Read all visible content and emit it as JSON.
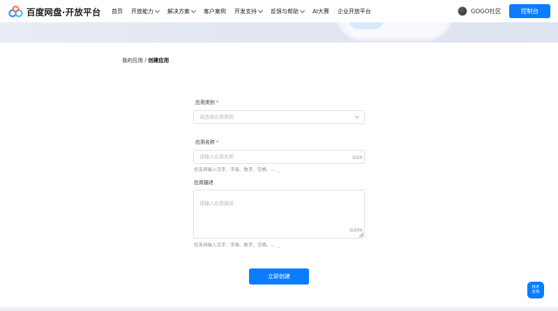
{
  "header": {
    "logo_text": "百度网盘·开放平台",
    "nav": [
      {
        "label": "首页",
        "has_dropdown": false
      },
      {
        "label": "开放能力",
        "has_dropdown": true
      },
      {
        "label": "解决方案",
        "has_dropdown": true
      },
      {
        "label": "客户案例",
        "has_dropdown": false
      },
      {
        "label": "开发支持",
        "has_dropdown": true
      },
      {
        "label": "反馈与帮助",
        "has_dropdown": true
      },
      {
        "label": "AI大赛",
        "has_dropdown": false
      },
      {
        "label": "企业开放平台",
        "has_dropdown": false
      }
    ],
    "user_name": "GOGO社区",
    "console_label": "控制台"
  },
  "breadcrumb": {
    "parent": "我的应用",
    "separator": "/",
    "current": "创建应用"
  },
  "form": {
    "category": {
      "label": "应用类别",
      "required_mark": "*",
      "placeholder": "请选择应用类别"
    },
    "name": {
      "label": "应用名称",
      "required_mark": "*",
      "placeholder": "请输入应用名称",
      "counter": "0/20",
      "hint": "仅支持输入汉字、字母、数字、空格、-、_"
    },
    "description": {
      "label": "应用描述",
      "placeholder": "请输入应用描述",
      "counter": "0/200",
      "hint": "仅支持输入汉字、字母、数字、空格、-、_"
    },
    "submit_label": "立即创建"
  },
  "support": {
    "line1": "技术",
    "line2": "支持"
  },
  "colors": {
    "primary": "#0a7cff",
    "required": "#ee3333"
  }
}
